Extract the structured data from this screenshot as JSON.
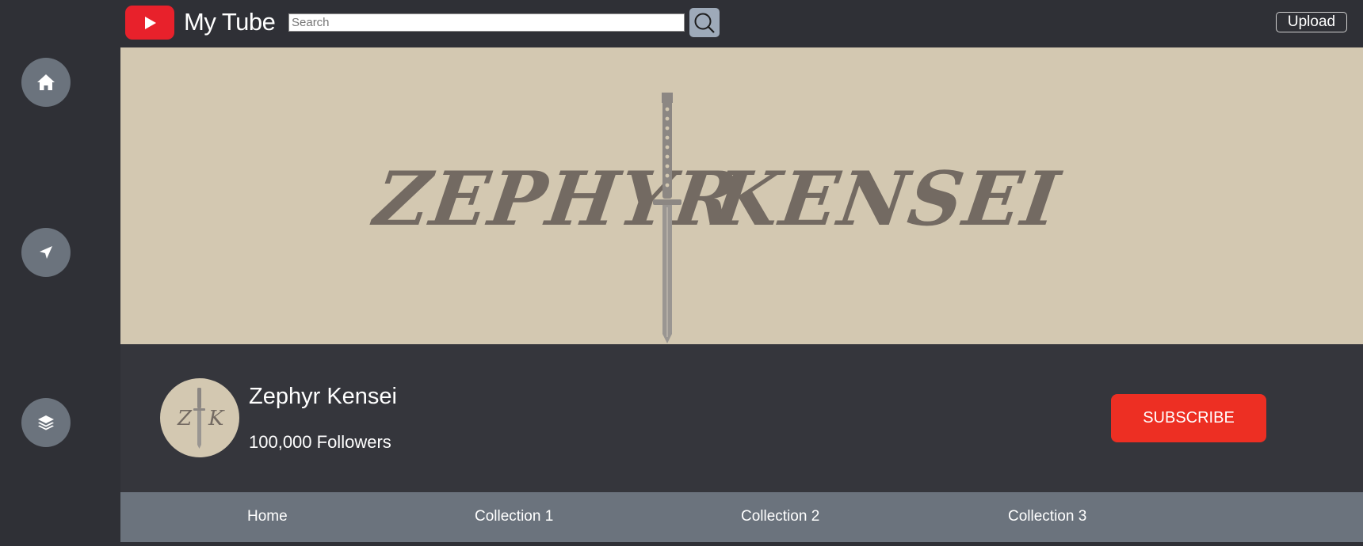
{
  "app": {
    "brand": "My Tube"
  },
  "topbar": {
    "search_placeholder": "Search",
    "upload_label": "Upload"
  },
  "rail": {
    "items": [
      {
        "name": "home",
        "icon": "home-icon"
      },
      {
        "name": "explore",
        "icon": "navigation-arrow-icon"
      },
      {
        "name": "library",
        "icon": "layers-icon"
      }
    ]
  },
  "banner": {
    "left_word": "ZEPHYR",
    "right_word": "KENSEI"
  },
  "avatar": {
    "left_letter": "Z",
    "right_letter": "K"
  },
  "channel": {
    "name": "Zephyr Kensei",
    "followers": "100,000 Followers",
    "subscribe_label": "SUBSCRIBE"
  },
  "tabs": [
    {
      "label": "Home"
    },
    {
      "label": "Collection 1"
    },
    {
      "label": "Collection 2"
    },
    {
      "label": "Collection 3"
    }
  ],
  "colors": {
    "background": "#2f3036",
    "banner": "#d3c8b1",
    "brand_red": "#e8212b",
    "subscribe": "#ed2f23",
    "tab_bar": "#6b737d",
    "search_button": "#9eaab9"
  }
}
